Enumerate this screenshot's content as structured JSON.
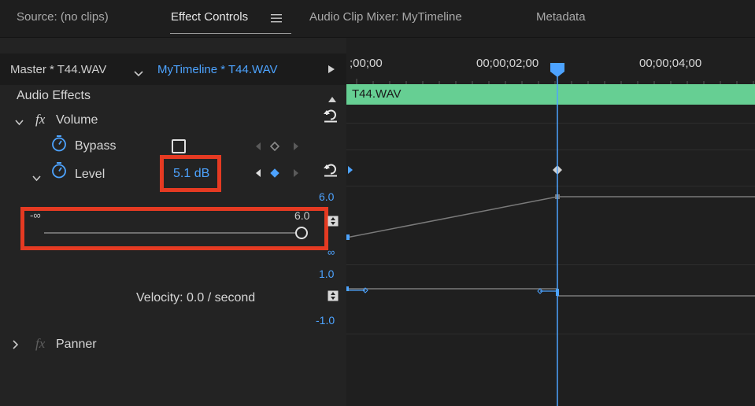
{
  "tabs": [
    {
      "label": "Source: (no clips)"
    },
    {
      "label": "Effect Controls"
    },
    {
      "label": "Audio Clip Mixer: MyTimeline"
    },
    {
      "label": "Metadata"
    }
  ],
  "effect_controls_menu_icon": "hamburger-icon",
  "source": {
    "master_label": "Master * T44.WAV",
    "sequence_label": "MyTimeline * T44.WAV"
  },
  "timeline": {
    "timecodes": [
      ";00;00",
      "00;00;02;00",
      "00;00;04;00"
    ],
    "clip_name": "T44.WAV"
  },
  "effects": {
    "section_title": "Audio Effects",
    "volume": {
      "fx_symbol": "fx",
      "name": "Volume",
      "bypass": {
        "label": "Bypass",
        "checked": false
      },
      "level": {
        "label": "Level",
        "value": "5.1 dB",
        "slider_min": "-∞",
        "slider_max": "6.0",
        "slider_position": 1.0,
        "graph_top": "6.0",
        "graph_bottom": "∞"
      },
      "velocity": {
        "text": "Velocity: 0.0 / second",
        "graph_top": "1.0",
        "graph_bottom": "-1.0"
      }
    },
    "panner": {
      "fx_symbol": "fx",
      "name": "Panner"
    }
  },
  "colors": {
    "accent_blue": "#4da3ff",
    "highlight_red": "#e53a22",
    "clip_green": "#66cf93",
    "panel_bg": "#232323"
  }
}
